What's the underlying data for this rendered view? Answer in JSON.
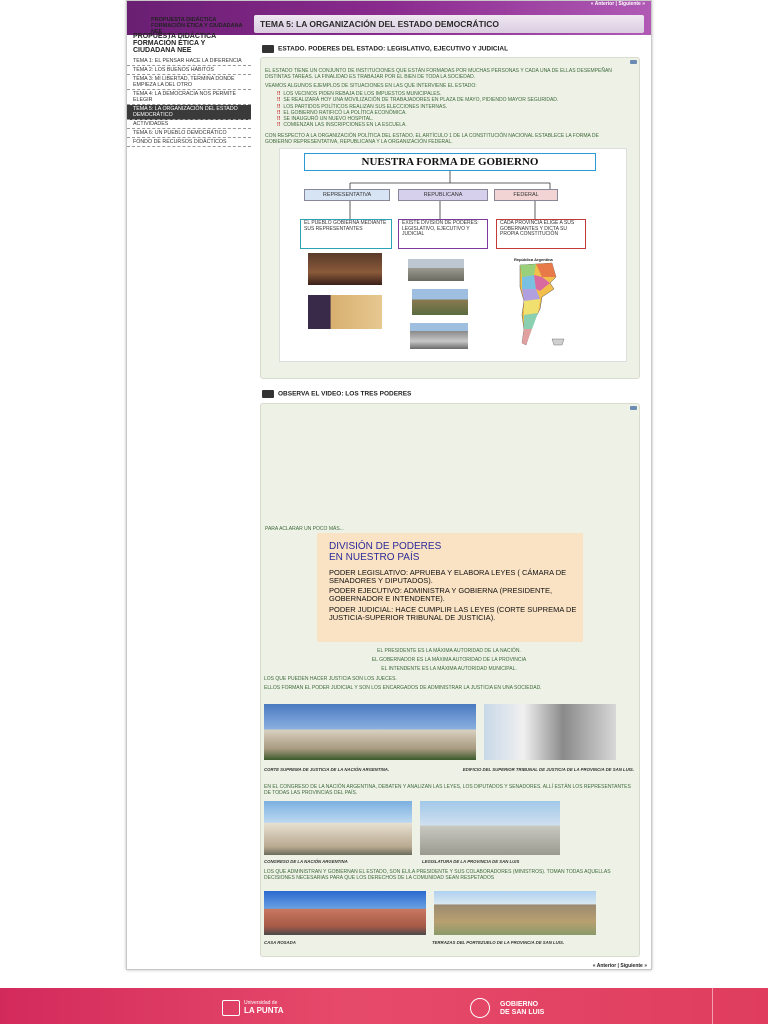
{
  "header": {
    "nav_top": "« Anterior | Siguiente »",
    "tema_title": "TEMA 5: LA ORGANIZACIÓN DEL ESTADO DEMOCRÁTICO",
    "small_title": "PROPUESTA DIDÁCTICA FORMACIÓN ÉTICA Y CIUDADANA NEE"
  },
  "sidebar": {
    "heading": "PROPUESTA DIDÁCTICA FORMACIÓN ÉTICA Y CIUDADANA NEE",
    "items": [
      {
        "label": "TEMA 1: EL PENSAR HACE LA DIFERENCIA"
      },
      {
        "label": "TEMA 2: LOS BUENOS HÁBITOS"
      },
      {
        "label": "TEMA 3: MI LIBERTAD, TERMINA DONDE EMPIEZA LA DEL OTRO"
      },
      {
        "label": "TEMA 4: LA DEMOCRACIA NOS PERMITE ELEGIR"
      },
      {
        "label": "TEMA 5: LA ORGANIZACIÓN DEL ESTADO DEMOCRÁTICO"
      },
      {
        "label": "ACTIVIDADES"
      },
      {
        "label": "TEMA 6: UN PUEBLO DEMOCRÁTICO"
      },
      {
        "label": "FONDO DE RECURSOS DIDÁCTICOS"
      }
    ]
  },
  "section1": {
    "title": "ESTADO. PODERES DEL ESTADO: LEGISLATIVO, EJECUTIVO Y JUDICIAL",
    "intro": "EL ESTADO TIENE UN CONJUNTO DE INSTITUCIONES QUE ESTÁN FORMADAS POR MUCHAS PERSONAS Y CADA UNA DE ELLAS DESEMPEÑAN DISTINTAS TAREAS. LA FINALIDAD ES TRABAJAR POR EL BIEN DE TODA LA SOCIEDAD.",
    "examples_intro": "VEAMOS ALGUNOS EJEMPLOS DE SITUACIONES EN LAS QUE INTERVIENE EL ESTADO:",
    "bullets": [
      "LOS VECINOS PIDEN REBAJA DE LOS IMPUESTOS MUNICIPALES.",
      "SE REALIZARÁ HOY UNA MOVILIZACIÓN DE TRABAJADORES EN PLAZA DE MAYO, PIDIENDO MAYOR SEGURIDAD.",
      "LOS PARTIDOS POLÍTICOS REALIZAN SUS ELECCIONES INTERNAS.",
      "EL GOBIERNO RATIFICÓ LA POLÍTICA ECONÓMICA.",
      "SE INAUGURÓ UN NUEVO HOSPITAL.",
      "COMIENZAN LAS INSCRIPCIONES EN LA ESCUELA."
    ],
    "constitution": "CON RESPECTO A LA ORGANIZACIÓN POLÍTICA DEL ESTADO, EL ARTÍCULO 1 DE LA CONSTITUCIÓN NACIONAL ESTABLECE LA FORMA DE GOBIERNO REPRESENTATIVA, REPUBLICANA Y LA ORGANIZACIÓN FEDERAL."
  },
  "gov_image": {
    "title": "NUESTRA FORMA DE GOBIERNO",
    "boxes": [
      "REPRESENTATIVA",
      "REPUBLICANA",
      "FEDERAL"
    ],
    "descs": [
      "EL PUEBLO GOBIERNA MEDIANTE SUS REPRESENTANTES",
      "EXISTE DIVISIÓN DE PODERES: LEGISLATIVO, EJECUTIVO Y JUDICIAL",
      "CADA PROVINCIA ELIGE A SUS GOBERNANTES Y DICTA SU PROPIA CONSTITUCIÓN"
    ],
    "map_label": "República Argentina"
  },
  "section2": {
    "title": "OBSERVA EL VIDEO: LOS TRES PODERES",
    "aclarar": "PARA ACLARAR UN POCO MÁS...",
    "poderes_title_1": "DIVISIÓN DE PODERES",
    "poderes_title_2": "EN NUESTRO PAÍS",
    "poder_leg": "PODER LEGISLATIVO: APRUEBA Y ELABORA LEYES ( CÁMARA DE SENADORES Y DIPUTADOS).",
    "poder_ej": "PODER EJECUTIVO: ADMINISTRA Y GOBIERNA (PRESIDENTE, GOBERNADOR E INTENDENTE).",
    "poder_jud": "PODER JUDICIAL: HACE CUMPLIR LAS LEYES (CORTE SUPREMA DE JUSTICIA-SUPERIOR TRIBUNAL DE JUSTICIA).",
    "presidente": "EL PRESIDENTE ES LA MÁXIMA AUTORIDAD DE LA NACIÓN.",
    "gobernador": "EL GOBERNADOR ES LA MÁXIMA AUTORIDAD DE LA PROVINCIA",
    "intendente": "EL INTENDENTE ES LA MÁXIMA AUTORIDAD MUNICIPAL.",
    "jueces": "LOS QUE PUEDEN HACER JUSTICIA SON LOS JUECES.",
    "judicial_text": "ELLOS FORMAN EL PODER JUDICIAL Y SON LOS ENCARGADOS DE ADMINISTRAR LA JUSTICIA EN UNA SOCIEDAD.",
    "cap_corte": "CORTE SUPREMA DE JUSTICIA DE LA NACIÓN ARGENTINA.",
    "cap_edificio": "EDIFICIO DEL SUPERIOR TRIBUNAL DE JUSTICIA DE LA PROVINCIA DE SAN LUIS.",
    "congreso_text": "EN EL CONGRESO DE LA NACIÓN ARGENTINA, DEBATEN Y ANALIZAN LAS LEYES, LOS DIPUTADOS Y SENADORES. ALLÍ ESTÁN LOS REPRESENTANTES DE TODAS LAS PROVINCIAS DEL PAÍS.",
    "cap_congreso": "CONGRESO DE LA NACIÓN ARGENTINA",
    "cap_legislatura": "LEGISLATURA DE LA PROVINCIA DE SAN LUIS",
    "ejecutivo_text": "LOS QUE ADMINISTRAN Y GOBIERNAN EL ESTADO, SON EL/LA PRESIDENTE Y SUS COLABORADORES (MINISTROS). TOMAN TODAS AQUELLAS DECISIONES NECESARIAS PARA QUE LOS DERECHOS DE LA COMUNIDAD SEAN RESPETADOS",
    "cap_casa": "CASA ROSADA",
    "cap_terrazas": "TERRAZAS DEL PORTEZUELO DE LA PROVINCIA DE SAN LUIS."
  },
  "footer": {
    "nav": "« Anterior | Siguiente »",
    "logo1_small": "Universidad de",
    "logo1_big": "LA PUNTA",
    "logo2_line1": "GOBIERNO",
    "logo2_line2": "DE SAN LUIS"
  }
}
